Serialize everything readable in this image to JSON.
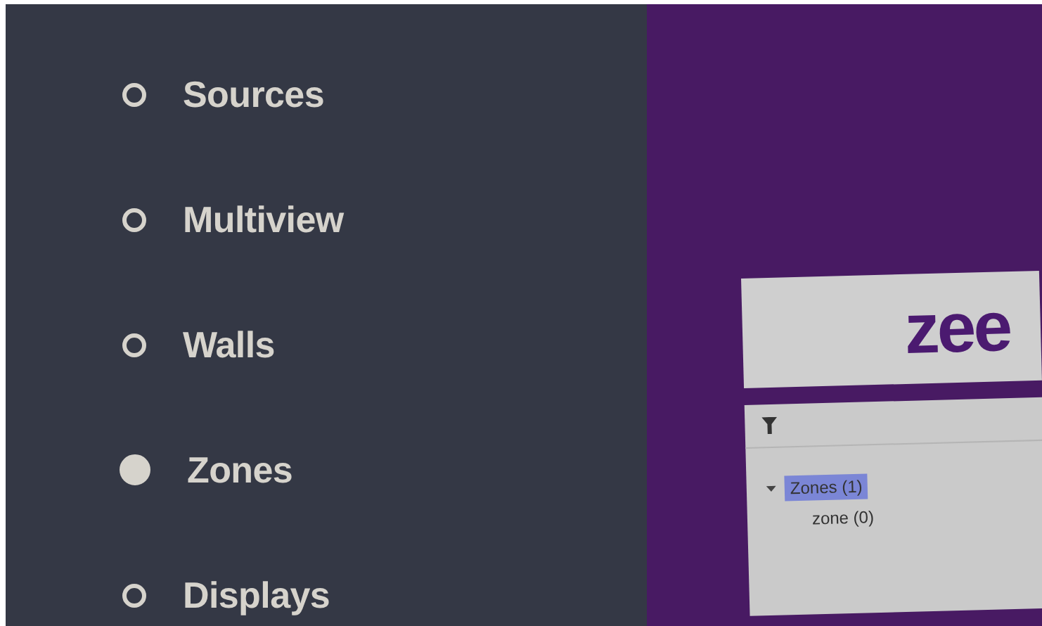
{
  "menu": {
    "items": [
      {
        "label": "Sources",
        "selected": false
      },
      {
        "label": "Multiview",
        "selected": false
      },
      {
        "label": "Walls",
        "selected": false
      },
      {
        "label": "Zones",
        "selected": true
      },
      {
        "label": "Displays",
        "selected": false
      }
    ]
  },
  "preview": {
    "logo": "zee",
    "tree": [
      {
        "label": "Zones (1)",
        "selected": true,
        "expanded": true,
        "children": [
          {
            "label": "zone (0)",
            "selected": false
          }
        ]
      }
    ]
  }
}
